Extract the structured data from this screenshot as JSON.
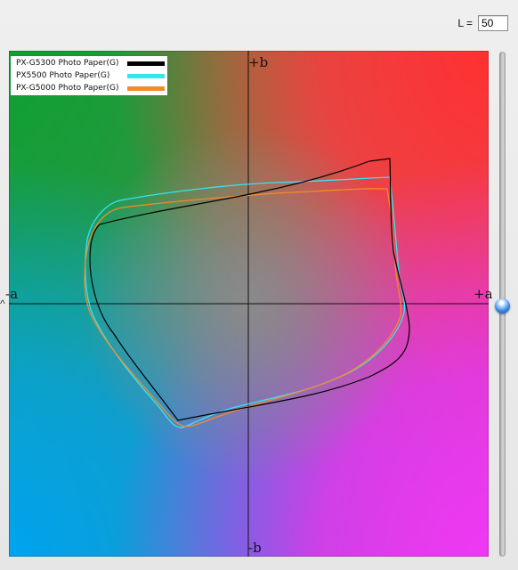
{
  "controls": {
    "l_label": "L =",
    "l_value": "50"
  },
  "axes": {
    "top": "+b",
    "bottom": "-b",
    "left": "-a",
    "right": "+a"
  },
  "legend": [
    {
      "name": "PX-G5300 Photo Paper(G)",
      "color": "#000000"
    },
    {
      "name": "PX5500 Photo Paper(G)",
      "color": "#33e6f0"
    },
    {
      "name": "PX-G5000 Photo Paper(G)",
      "color": "#f58a2a"
    }
  ],
  "slider": {
    "level_fraction": 0.5
  }
}
